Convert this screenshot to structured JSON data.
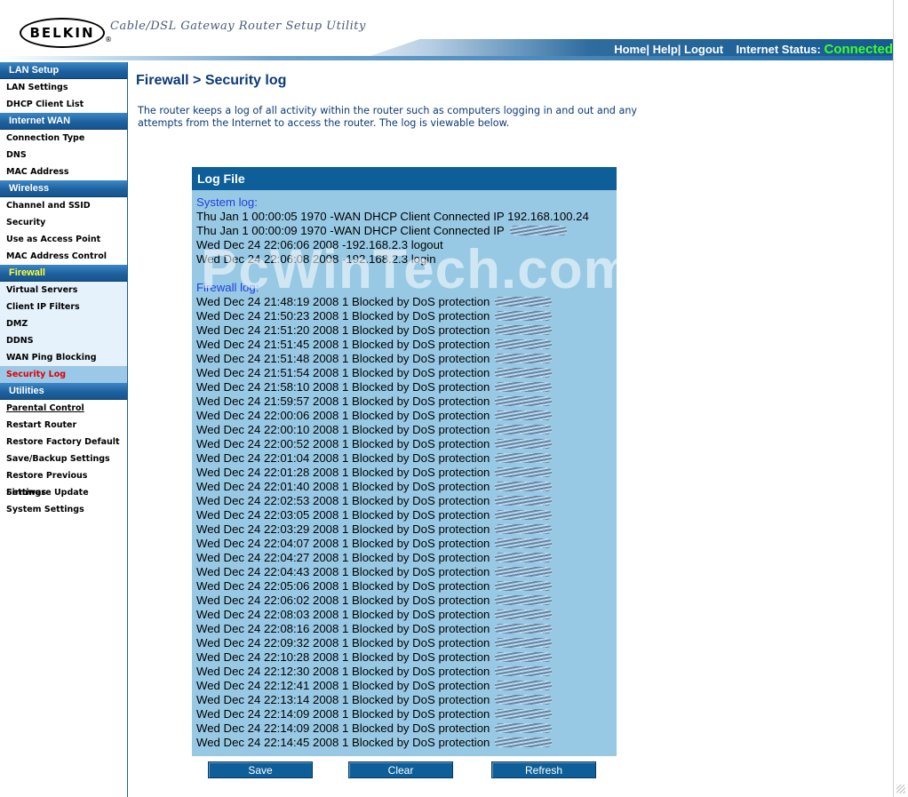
{
  "header": {
    "logo": "BELKIN",
    "tagline": "Cable/DSL Gateway Router Setup Utility",
    "links": [
      "Home",
      "Help",
      "Logout"
    ],
    "status_label": "Internet Status:",
    "status_value": "Connected"
  },
  "sidebar": {
    "sections": [
      {
        "title": "LAN Setup",
        "items": [
          "LAN Settings",
          "DHCP Client List"
        ]
      },
      {
        "title": "Internet WAN",
        "items": [
          "Connection Type",
          "DNS",
          "MAC Address"
        ]
      },
      {
        "title": "Wireless",
        "items": [
          "Channel and SSID",
          "Security",
          "Use as Access Point",
          "MAC Address Control"
        ]
      },
      {
        "title": "Firewall",
        "items": [
          "Virtual Servers",
          "Client IP Filters",
          "DMZ",
          "DDNS",
          "WAN Ping Blocking",
          "Security Log"
        ]
      },
      {
        "title": "Utilities",
        "items": [
          "Parental Control",
          "Restart Router",
          "Restore Factory Default",
          "Save/Backup Settings",
          "Restore Previous Settings",
          "Firmware Update",
          "System Settings"
        ]
      }
    ],
    "active_section": "Firewall",
    "active_item": "Security Log"
  },
  "main": {
    "title": "Firewall > Security log",
    "intro": "The router keeps a log of all activity within the router such as computers logging in and out and any attempts from the Internet to access the router. The log is viewable below."
  },
  "log": {
    "header": "Log File",
    "system_label": "System log:",
    "system_lines": [
      "Thu Jan 1 00:00:05 1970 -WAN DHCP Client Connected IP 192.168.100.24",
      "Thu Jan 1 00:00:09 1970 -WAN DHCP Client Connected IP",
      "Wed Dec 24 22:06:06 2008 -192.168.2.3 logout",
      "Wed Dec 24 22:06:08 2008 -192.168.2.3 login"
    ],
    "firewall_label": "Firewall log:",
    "firewall_lines": [
      "Wed Dec 24 21:48:19 2008 1 Blocked by DoS protection",
      "Wed Dec 24 21:50:23 2008 1 Blocked by DoS protection",
      "Wed Dec 24 21:51:20 2008 1 Blocked by DoS protection",
      "Wed Dec 24 21:51:45 2008 1 Blocked by DoS protection",
      "Wed Dec 24 21:51:48 2008 1 Blocked by DoS protection",
      "Wed Dec 24 21:51:54 2008 1 Blocked by DoS protection",
      "Wed Dec 24 21:58:10 2008 1 Blocked by DoS protection",
      "Wed Dec 24 21:59:57 2008 1 Blocked by DoS protection",
      "Wed Dec 24 22:00:06 2008 1 Blocked by DoS protection",
      "Wed Dec 24 22:00:10 2008 1 Blocked by DoS protection",
      "Wed Dec 24 22:00:52 2008 1 Blocked by DoS protection",
      "Wed Dec 24 22:01:04 2008 1 Blocked by DoS protection",
      "Wed Dec 24 22:01:28 2008 1 Blocked by DoS protection",
      "Wed Dec 24 22:01:40 2008 1 Blocked by DoS protection",
      "Wed Dec 24 22:02:53 2008 1 Blocked by DoS protection",
      "Wed Dec 24 22:03:05 2008 1 Blocked by DoS protection",
      "Wed Dec 24 22:03:29 2008 1 Blocked by DoS protection",
      "Wed Dec 24 22:04:07 2008 1 Blocked by DoS protection",
      "Wed Dec 24 22:04:27 2008 1 Blocked by DoS protection",
      "Wed Dec 24 22:04:43 2008 1 Blocked by DoS protection",
      "Wed Dec 24 22:05:06 2008 1 Blocked by DoS protection",
      "Wed Dec 24 22:06:02 2008 1 Blocked by DoS protection",
      "Wed Dec 24 22:08:03 2008 1 Blocked by DoS protection",
      "Wed Dec 24 22:08:16 2008 1 Blocked by DoS protection",
      "Wed Dec 24 22:09:32 2008 1 Blocked by DoS protection",
      "Wed Dec 24 22:10:28 2008 1 Blocked by DoS protection",
      "Wed Dec 24 22:12:30 2008 1 Blocked by DoS protection",
      "Wed Dec 24 22:12:41 2008 1 Blocked by DoS protection",
      "Wed Dec 24 22:13:14 2008 1 Blocked by DoS protection",
      "Wed Dec 24 22:14:09 2008 1 Blocked by DoS protection",
      "Wed Dec 24 22:14:09 2008 1 Blocked by DoS protection",
      "Wed Dec 24 22:14:45 2008 1 Blocked by DoS protection"
    ],
    "watermark": "PcWinTech.com"
  },
  "buttons": {
    "save": "Save",
    "clear": "Clear",
    "refresh": "Refresh"
  },
  "colors": {
    "brand_blue": "#0e5f99",
    "log_bg": "#98c9e4",
    "status_green": "#40ff20",
    "active_item_red": "#e00000"
  }
}
